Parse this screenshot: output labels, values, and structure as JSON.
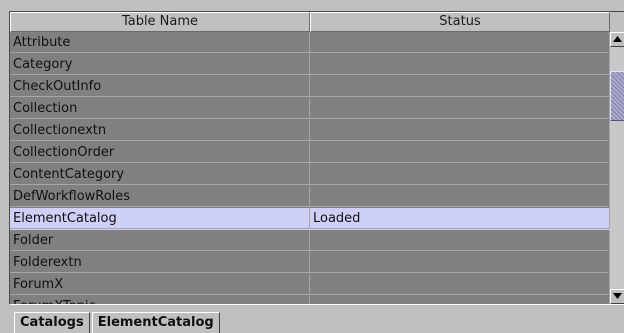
{
  "table": {
    "columns": {
      "name": "Table Name",
      "status": "Status"
    },
    "rows": [
      {
        "name": "Attribute",
        "status": ""
      },
      {
        "name": "Category",
        "status": ""
      },
      {
        "name": "CheckOutInfo",
        "status": ""
      },
      {
        "name": "Collection",
        "status": ""
      },
      {
        "name": "Collectionextn",
        "status": ""
      },
      {
        "name": "CollectionOrder",
        "status": ""
      },
      {
        "name": "ContentCategory",
        "status": ""
      },
      {
        "name": "DefWorkflowRoles",
        "status": ""
      },
      {
        "name": "ElementCatalog",
        "status": "Loaded",
        "selected": true
      },
      {
        "name": "Folder",
        "status": ""
      },
      {
        "name": "Folderextn",
        "status": ""
      },
      {
        "name": "ForumX",
        "status": ""
      },
      {
        "name": "ForumXTopic",
        "status": ""
      }
    ]
  },
  "tabs": [
    {
      "label": "Catalogs",
      "active": true
    },
    {
      "label": "ElementCatalog",
      "active": false
    }
  ],
  "colors": {
    "row_background": "#808080",
    "selected_row": "#cfd0f8",
    "window_background": "#c0c0c0",
    "scroll_thumb": "#9ea0c2"
  },
  "icons": {
    "scroll_up": "triangle-up-icon",
    "scroll_down": "triangle-down-icon"
  }
}
